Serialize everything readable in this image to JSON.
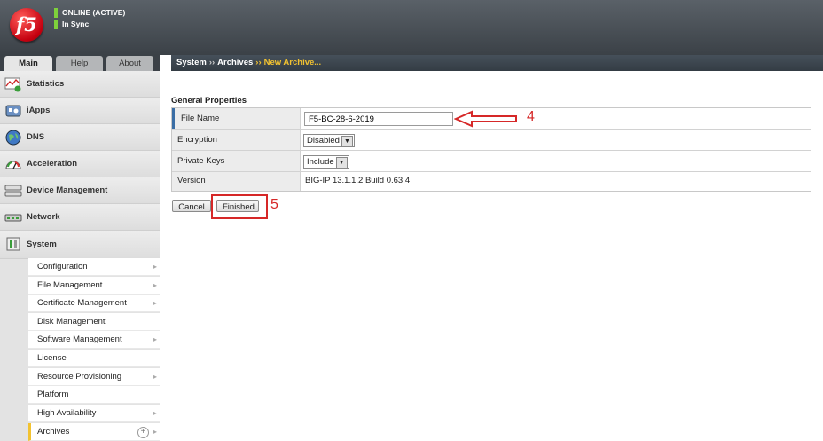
{
  "header": {
    "logo_text": "f5",
    "status": "ONLINE (ACTIVE)",
    "sync": "In Sync"
  },
  "tabs": [
    {
      "label": "Main"
    },
    {
      "label": "Help"
    },
    {
      "label": "About"
    }
  ],
  "sidebar": {
    "items": [
      {
        "label": "Statistics",
        "icon": "statistics-icon"
      },
      {
        "label": "iApps",
        "icon": "iapps-icon"
      },
      {
        "label": "DNS",
        "icon": "globe-icon"
      },
      {
        "label": "Acceleration",
        "icon": "gauge-icon"
      },
      {
        "label": "Device Management",
        "icon": "device-icon"
      },
      {
        "label": "Network",
        "icon": "network-icon"
      },
      {
        "label": "System",
        "icon": "system-icon"
      }
    ],
    "subitems": [
      {
        "label": "Configuration"
      },
      {
        "label": "File Management"
      },
      {
        "label": "Certificate Management"
      },
      {
        "label": "Disk Management"
      },
      {
        "label": "Software Management"
      },
      {
        "label": "License"
      },
      {
        "label": "Resource Provisioning"
      },
      {
        "label": "Platform"
      },
      {
        "label": "High Availability"
      },
      {
        "label": "Archives"
      }
    ]
  },
  "breadcrumb": {
    "part1": "System",
    "part2": "Archives",
    "current": "New Archive...",
    "separator": "››"
  },
  "form": {
    "section_title": "General Properties",
    "rows": [
      {
        "label": "File Name",
        "value": "F5-BC-28-6-2019"
      },
      {
        "label": "Encryption",
        "value": "Disabled"
      },
      {
        "label": "Private Keys",
        "value": "Include"
      },
      {
        "label": "Version",
        "value": "BIG-IP 13.1.1.2 Build 0.63.4"
      }
    ],
    "cancel_label": "Cancel",
    "finished_label": "Finished"
  },
  "annotations": {
    "step4": "4",
    "step5": "5",
    "color": "#d62828"
  },
  "colors": {
    "accent": "#f2c230",
    "status_green": "#7ed13b",
    "header": "#4a5157"
  }
}
